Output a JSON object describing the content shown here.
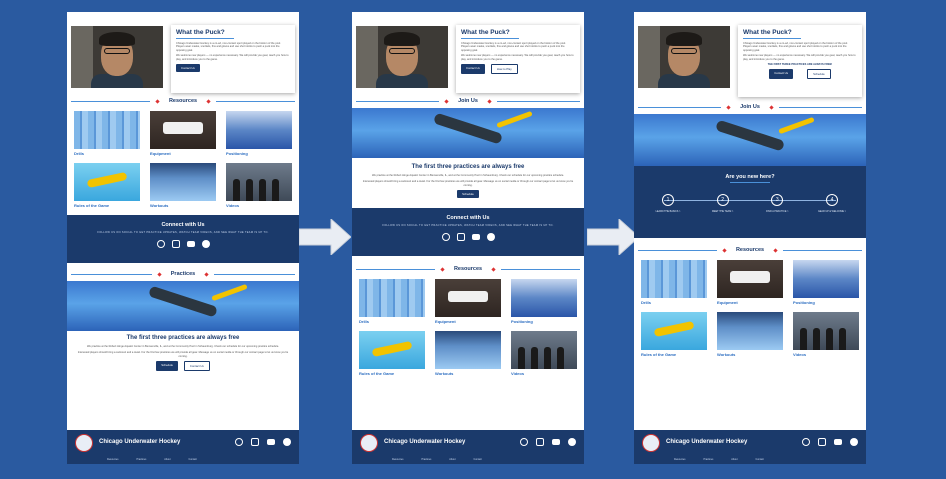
{
  "hero": {
    "title": "What the Puck?",
    "p1": "Chicago Underwater Hockey is a co-ed, non-contact sport played on the bottom of the pool. Players wear masks, snorkels, fins and gloves and use short sticks to push a puck into the opposing goal.",
    "p2": "We welcome new players — no experience necessary. We will provide you gear, teach you how to play, and introduce you to the game.",
    "btn_primary": "Contact Us",
    "btn_outline": "How to Play",
    "btn_outline_alt": "Schedule",
    "note": "THE FIRST THREE PRACTICES ARE ALWAYS FREE!"
  },
  "sections": {
    "resources": "Resources",
    "practices": "Practices",
    "join": "Join Us"
  },
  "resources": [
    "Drills",
    "Equipment",
    "Positioning",
    "Rules of the Game",
    "Workouts",
    "Videos"
  ],
  "connect": {
    "title": "Connect with Us",
    "sub": "FOLLOW US ON SOCIAL TO GET PRACTICE UPDATES, WATCH TEAM VIDEOS, AND SEE WHAT THE TEAM IS UP TO."
  },
  "free": {
    "title": "The first three practices are always free",
    "p1": "We practice at the Robert Hinge Aquatic Center in Bensenville, IL, and at the Community Pool in Schaumburg. Check our schedule for our upcoming practice schedule.",
    "p2": "Interested players should bring a swimsuit and a towel. For the first few practices we will provide all gear. Message us on social media or through our contact page to let us know you're coming.",
    "btn_primary": "Schedule",
    "btn_outline": "Contact Us"
  },
  "new_here": {
    "title": "Are you new here?",
    "steps": [
      {
        "num": "1",
        "label": "LEARN THE BASICS >"
      },
      {
        "num": "2",
        "label": "MEET THE TEAM >"
      },
      {
        "num": "3",
        "label": "FIND A PRACTICE >"
      },
      {
        "num": "4",
        "label": "GEAR UP & WELCOME >"
      }
    ]
  },
  "footer": {
    "brand": "Chicago Underwater Hockey",
    "links": [
      "Resources",
      "Practices",
      "About",
      "Contact"
    ]
  },
  "colors": {
    "navy": "#1b3a6b",
    "accent": "#4a90d9",
    "background": "#2a5aa0",
    "star": "#dd3333"
  }
}
